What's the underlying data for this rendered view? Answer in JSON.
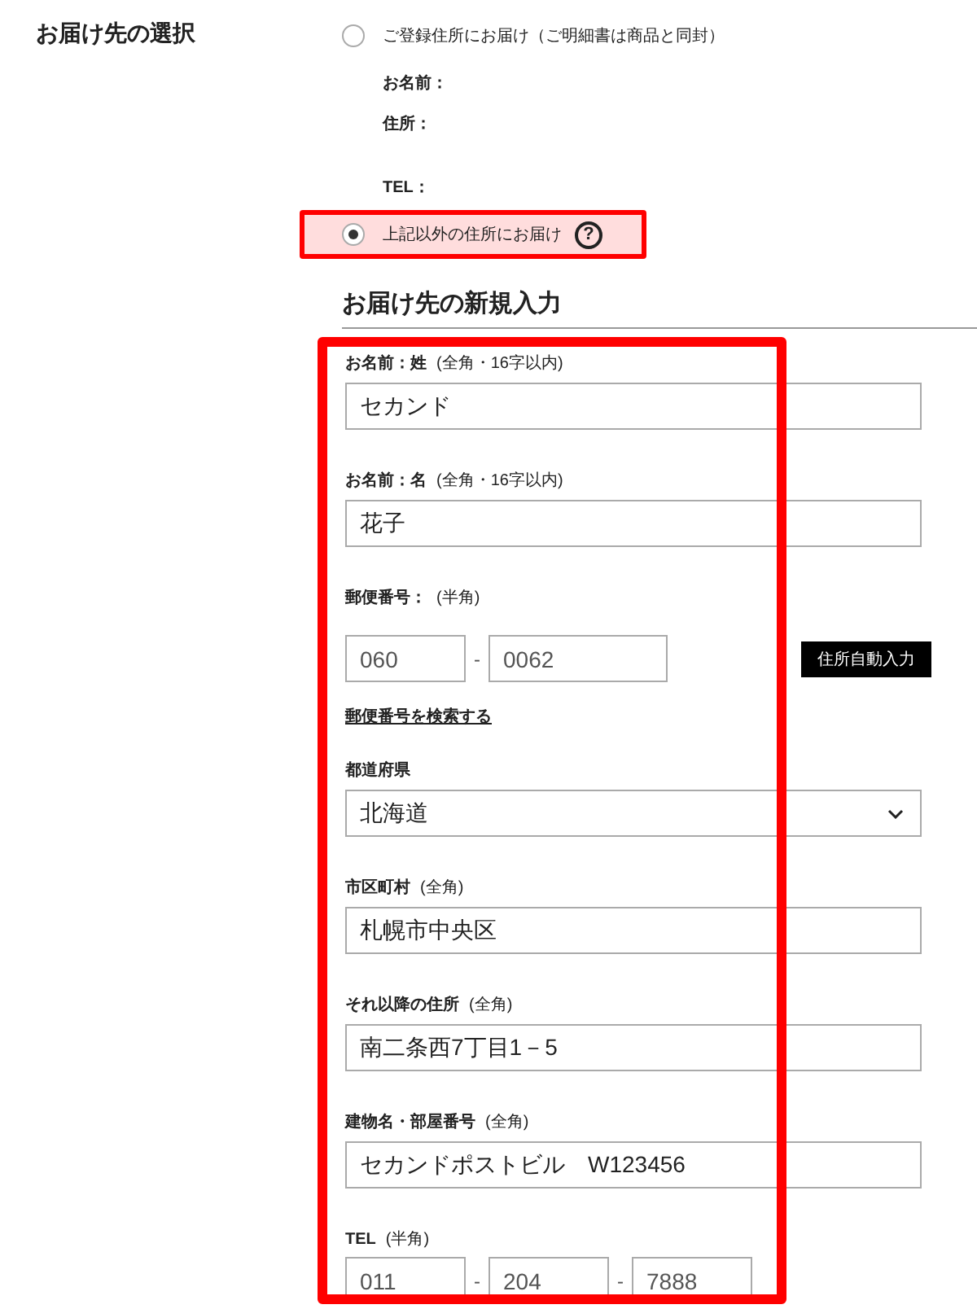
{
  "section_title": "お届け先の選択",
  "options": [
    {
      "label": "ご登録住所にお届け（ご明細書は商品と同封）",
      "selected": false,
      "highlighted": false,
      "details": [
        "お名前：",
        "住所：",
        "TEL："
      ]
    },
    {
      "label": "上記以外の住所にお届け",
      "selected": true,
      "highlighted": true,
      "help": "?"
    }
  ],
  "new_address": {
    "heading": "お届け先の新規入力",
    "highlighted": true,
    "fields": [
      {
        "kind": "text",
        "label": "お名前：姓",
        "note": "(全角・16字以内)",
        "value": "セカンド"
      },
      {
        "kind": "text",
        "label": "お名前：名",
        "note": "(全角・16字以内)",
        "value": "花子"
      },
      {
        "kind": "postal",
        "label": "郵便番号：",
        "note": "(半角)",
        "values": [
          "060",
          "0062"
        ],
        "separators": [
          "-"
        ],
        "button": "住所自動入力",
        "link": "郵便番号を検索する"
      },
      {
        "kind": "select",
        "label": "都道府県",
        "value": "北海道"
      },
      {
        "kind": "text",
        "label": "市区町村",
        "note": "(全角)",
        "value": "札幌市中央区"
      },
      {
        "kind": "text",
        "label": "それ以降の住所",
        "note": "(全角)",
        "value": "南二条西7丁目1－5"
      },
      {
        "kind": "text",
        "label": "建物名・部屋番号",
        "note": "(全角)",
        "value": "セカンドポストビル　W123456"
      },
      {
        "kind": "tel",
        "label": "TEL",
        "note": "(半角)",
        "values": [
          "011",
          "204",
          "7888"
        ],
        "separators": [
          "-",
          "-"
        ]
      }
    ]
  }
}
